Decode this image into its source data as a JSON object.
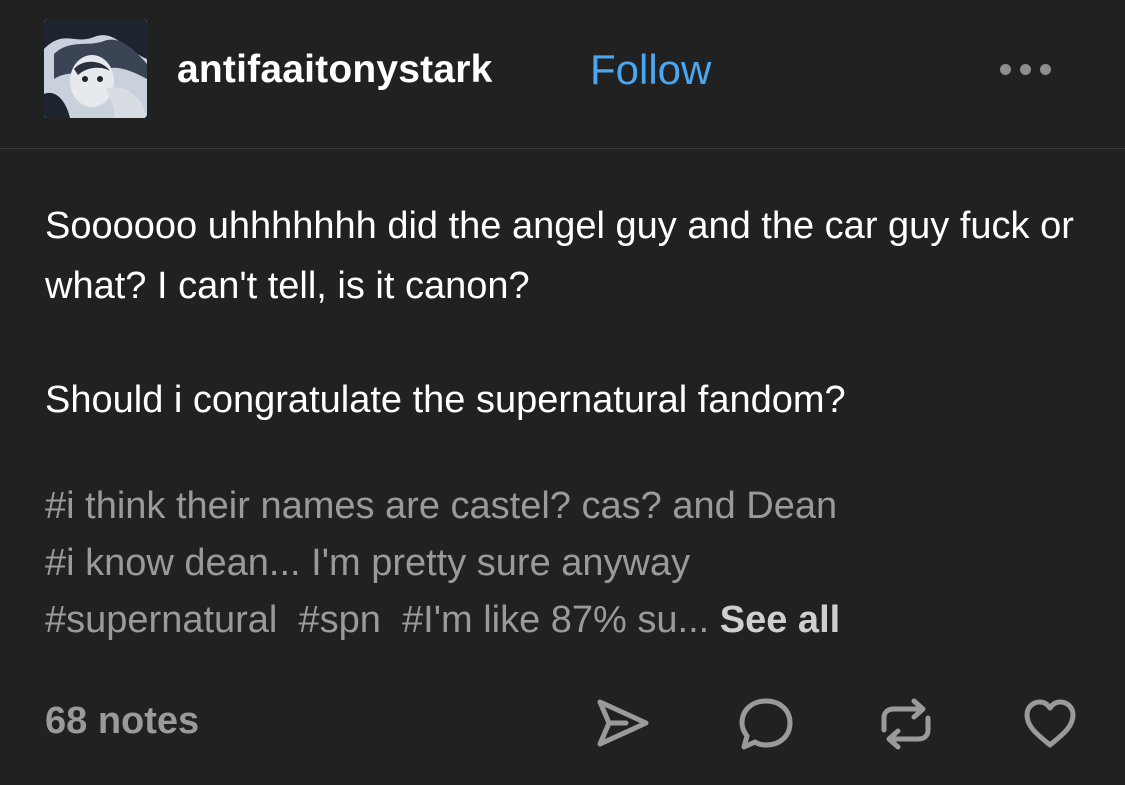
{
  "post": {
    "username": "antifaaitonystark",
    "follow_label": "Follow",
    "more_icon": "more-dots-icon",
    "paragraphs": [
      "Soooooo uhhhhhhh did the angel guy and the car guy fuck or what? I can't tell, is it canon?",
      "Should i congratulate the supernatural fandom?"
    ],
    "tags": {
      "line1": "#i think their names are castel? cas? and Dean",
      "line2": "#i know dean... I'm pretty sure anyway",
      "line3": [
        "#supernatural",
        "#spn",
        "#I'm like 87% su..."
      ],
      "see_all": "See all"
    },
    "footer": {
      "notes": "68 notes",
      "actions": [
        "share-icon",
        "reply-icon",
        "reblog-icon",
        "like-icon"
      ]
    }
  },
  "colors": {
    "background": "#212121",
    "follow": "#4aa6ee",
    "tag_text": "#9a9a9a",
    "icon": "#9a9a9a"
  }
}
